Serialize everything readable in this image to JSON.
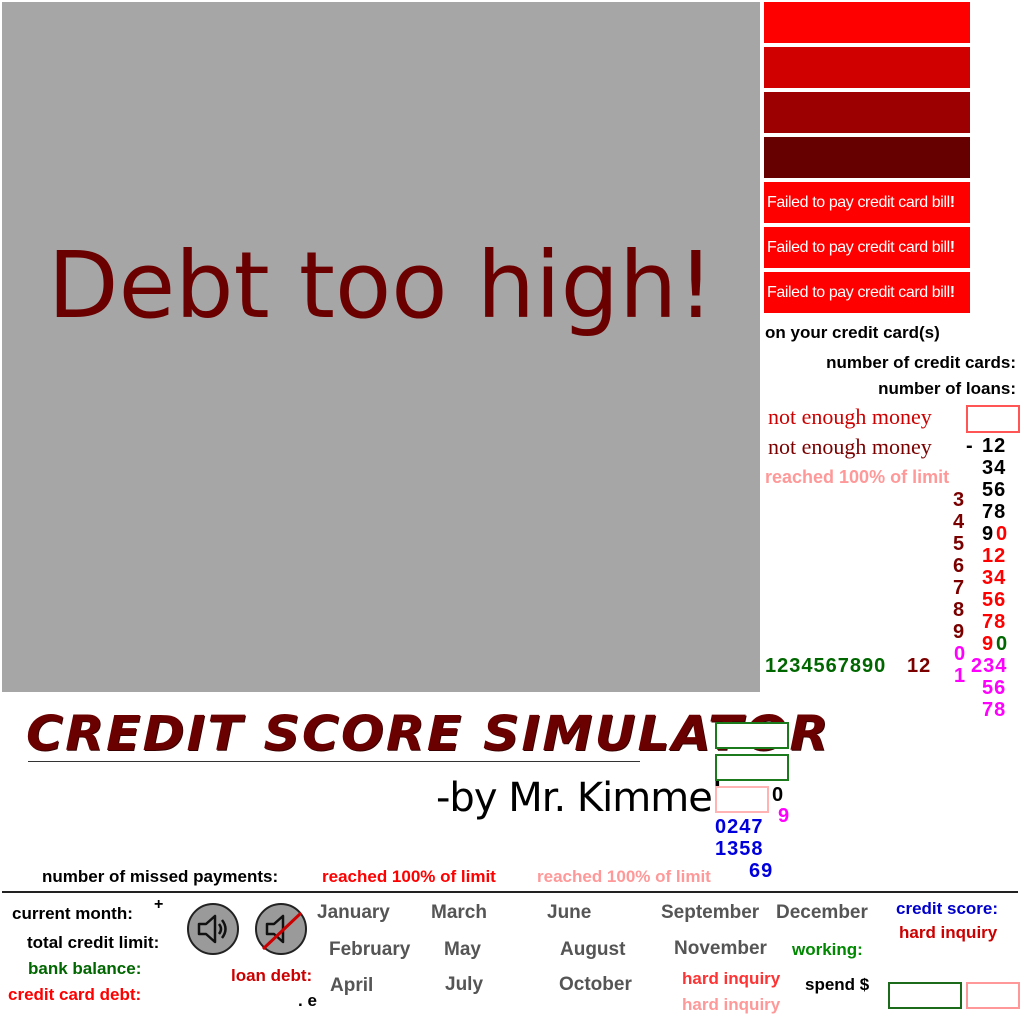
{
  "game": {
    "message": "Debt too high!"
  },
  "side_panel": {
    "bar_colors": [
      "#ff0000",
      "#d00000",
      "#9c0000",
      "#660000"
    ],
    "alerts": [
      "Failed to pay credit card bill",
      "Failed to pay credit card bill",
      "Failed to pay credit card bill"
    ],
    "alert_bang": "!",
    "on_your_cards": "on your credit card(s)",
    "num_credit_cards_label": "number of credit cards:",
    "num_loans_label": "number of loans:",
    "not_enough_1": "not enough money",
    "not_enough_2": "not enough money",
    "reached_limit": "reached 100% of limit",
    "minus": "-",
    "digits_black": [
      "12",
      "34",
      "56",
      "78",
      "9"
    ],
    "digit_red_zero": "0",
    "digits_red": [
      "12",
      "34",
      "56",
      "78",
      "9"
    ],
    "digit_green_zero": "0",
    "digits_darkred_col": [
      "3",
      "4",
      "5",
      "6",
      "7",
      "8",
      "9"
    ],
    "digit_mag_zero": "0",
    "digit_mag_one": "1",
    "digits_mag": [
      "234",
      "56",
      "78"
    ],
    "green_row": "1234567890",
    "darkred_row": "12"
  },
  "footer": {
    "title": "CREDIT SCORE SIMULATOR",
    "byline": "-by Mr. Kimmel",
    "small_zero": "0",
    "small_nine": "9",
    "blue_row1": "0247",
    "blue_row2": "1358",
    "blue_row3": "69",
    "missed_label": "number of missed payments:",
    "missed_reached_1": "reached 100% of limit",
    "missed_reached_2": "reached 100% of limit",
    "current_month_label": "current month:",
    "plus": "+",
    "total_credit_limit_label": "total credit limit:",
    "bank_balance_label": "bank balance:",
    "credit_card_debt_label": "credit card debt:",
    "loan_debt_label": "loan debt:",
    "dot_e": ". e",
    "months": {
      "january": "January",
      "march": "March",
      "june": "June",
      "september": "September",
      "december": "December",
      "february": "February",
      "may": "May",
      "august": "August",
      "november": "November",
      "april": "April",
      "july": "July",
      "october": "October"
    },
    "credit_score_label": "credit score:",
    "hard_inquiry_1": "hard inquiry",
    "hard_inquiry_2": "hard inquiry",
    "hard_inquiry_3": "hard inquiry",
    "working_label": "working:",
    "spend_label": "spend $"
  }
}
